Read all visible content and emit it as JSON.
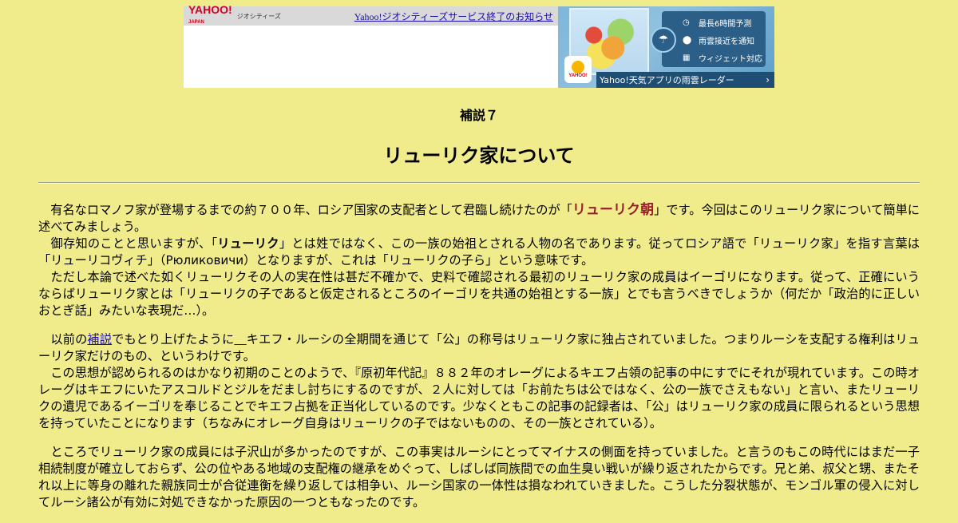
{
  "banner": {
    "yahoo_logo": "YAHOO!",
    "yahoo_japan": "JAPAN",
    "service_name": "ジオシティーズ",
    "notice_link": "Yahoo!ジオシティーズサービス終了のお知らせ",
    "weather_features": [
      "最長6時間予測",
      "雨雲接近を通知",
      "ウィジェット対応"
    ],
    "app_link": "Yahoo!天気アプリの雨雲レーダー",
    "sun_badge_text": "YAHOO!"
  },
  "page": {
    "supplement_label": "補説７",
    "title": "リューリク家について"
  },
  "paragraphs": {
    "p1": {
      "a_pre": "　有名なロマノフ家が登場するまでの約７００年、ロシア国家の支配者として君臨し続けたのが「",
      "a_red": "リューリク朝",
      "a_post": "」です。今回はこのリューリク家について簡単に述べてみましょう。",
      "b_pre": "　御存知のことと思いますが、「",
      "b_bold": "リューリク",
      "b_post": "」とは姓ではなく、この一族の始祖とされる人物の名であります。従ってロシア語で「リューリク家」を指す言葉は「リューリコヴィチ」（Рюликовичи）となりますが、これは「リューリクの子ら」という意味です。",
      "c": "　ただし本論で述べた如くリューリクその人の実在性は甚だ不確かで、史料で確認される最初のリューリク家の成員はイーゴリになります。従って、正確にいうならばリューリク家とは「リューリクの子であると仮定されるところのイーゴリを共通の始祖とする一族」とでも言うべきでしょうか（何だか「政治的に正しいおとぎ話」みたいな表現だ…）。"
    },
    "p2": {
      "a_pre": "　以前の",
      "a_link": "補説",
      "a_post": "でもとり上げたように",
      "a_link2": "　",
      "a_post2": "キエフ・ルーシの全期間を通じて「公」の称号はリューリク家に独占されていました。つまりルーシを支配する権利はリューリク家だけのもの、というわけです。",
      "b": "　この思想が認められるのはかなり初期のことのようで、『原初年代記』８８２年のオレーグによるキエフ占領の記事の中にすでにそれが現れています。この時オレーグはキエフにいたアスコルドとジルをだまし討ちにするのですが、２人に対しては「お前たちは公ではなく、公の一族でさえもない」と言い、またリューリクの遺児であるイーゴリを奉じることでキエフ占拠を正当化しているのです。少なくともこの記事の記録者は、「公」はリューリク家の成員に限られるという思想を持っていたことになります（ちなみにオレーグ自身はリューリクの子ではないものの、その一族とされている）。"
    },
    "p3": {
      "a": "　ところでリューリク家の成員には子沢山が多かったのですが、この事実はルーシにとってマイナスの側面を持っていました。と言うのもこの時代にはまだ一子相続制度が確立しておらず、公の位やある地域の支配権の継承をめぐって、しばしば同族間での血生臭い戦いが繰り返されたからです。兄と弟、叔父と甥、またそれ以上に等身の離れた親族同士が合従連衡を繰り返しては相争い、ルーシ国家の一体性は損なわれていきました。こうした分裂状態が、モンゴル軍の侵入に対してルーシ諸公が有効に対処できなかった原因の一つともなったのです。"
    }
  }
}
